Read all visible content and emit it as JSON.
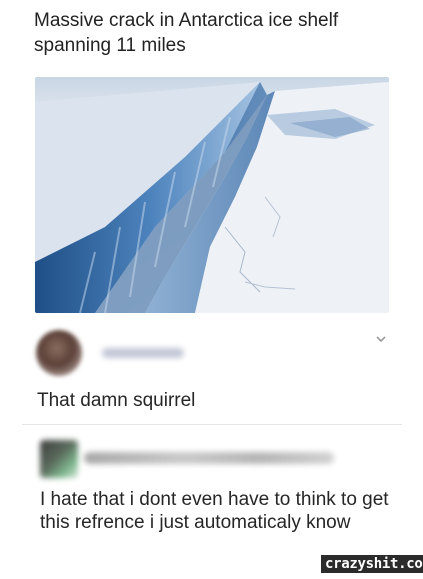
{
  "post": {
    "title_line1": "Massive crack in Antarctica ice shelf",
    "title_line2": "spanning 11 miles",
    "image_icon": "antarctica-ice-crack-photo"
  },
  "comment1": {
    "text": "That damn squirrel",
    "menu_icon": "chevron-down-icon"
  },
  "comment2": {
    "text": "I hate that i dont even have to think to get this refrence i just automaticaly know"
  },
  "watermark": {
    "text": "crazyshit.com"
  },
  "colors": {
    "ice_blue": "#3a6fa8",
    "snow": "#e9eef5",
    "text": "#262626"
  }
}
